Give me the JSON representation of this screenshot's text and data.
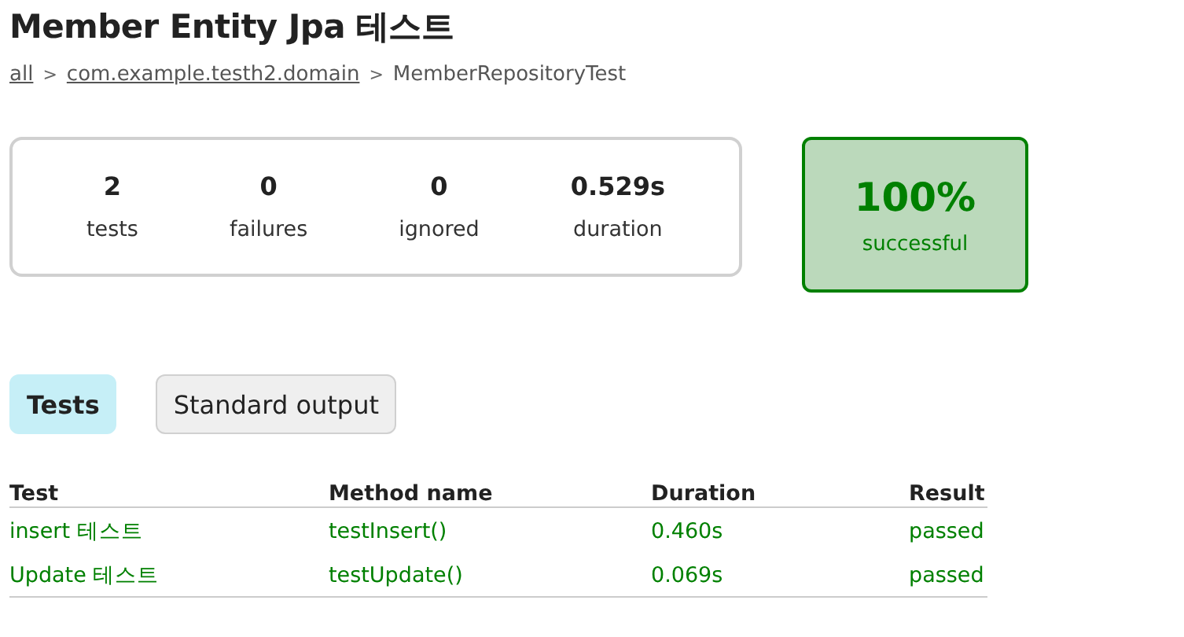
{
  "title": "Member Entity Jpa 테스트",
  "breadcrumb": [
    {
      "label": "all",
      "link": true
    },
    {
      "label": "com.example.testh2.domain",
      "link": true
    },
    {
      "label": "MemberRepositoryTest",
      "link": false
    }
  ],
  "breadcrumb_separator": ">",
  "summary": [
    {
      "value": "2",
      "label": "tests"
    },
    {
      "value": "0",
      "label": "failures"
    },
    {
      "value": "0",
      "label": "ignored"
    },
    {
      "value": "0.529s",
      "label": "duration"
    }
  ],
  "success_rate": {
    "value": "100%",
    "label": "successful",
    "success": true
  },
  "tabs": [
    {
      "label": "Tests",
      "selected": true
    },
    {
      "label": "Standard output",
      "selected": false
    }
  ],
  "table": {
    "columns": [
      "Test",
      "Method name",
      "Duration",
      "Result"
    ],
    "rows": [
      {
        "passed": true,
        "cells": [
          "insert 테스트",
          "testInsert()",
          "0.460s",
          "passed"
        ]
      },
      {
        "passed": true,
        "cells": [
          "Update 테스트",
          "testUpdate()",
          "0.069s",
          "passed"
        ]
      }
    ]
  }
}
